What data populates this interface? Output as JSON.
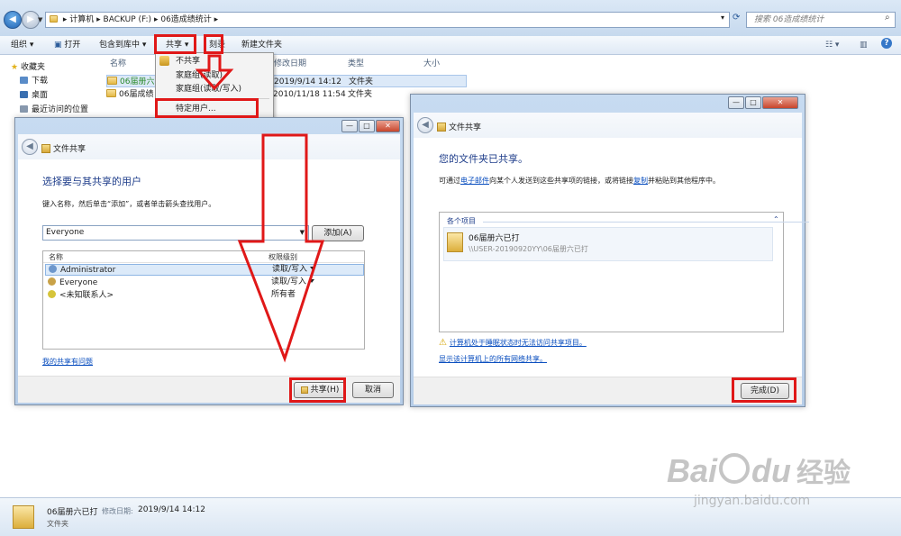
{
  "explorer": {
    "address": {
      "parts": [
        "计算机",
        "BACKUP (F:)",
        "06造成绩统计"
      ]
    },
    "search_placeholder": "搜索 06造成绩统计",
    "toolbar": {
      "organize": "组织",
      "open": "打开",
      "include_library": "包含到库中",
      "share": "共享",
      "burn": "刻录",
      "new_folder": "新建文件夹"
    },
    "sidebar": {
      "favorites": "收藏夹",
      "downloads": "下载",
      "desktop": "桌面",
      "recent": "最近访问的位置"
    },
    "columns": {
      "name": "名称",
      "date": "修改日期",
      "type": "类型",
      "size": "大小"
    },
    "files": [
      {
        "name": "06届册六",
        "date": "2019/9/14 14:12",
        "type": "文件夹"
      },
      {
        "name": "06届成绩",
        "date": "2010/11/18 11:54",
        "type": "文件夹"
      }
    ],
    "share_menu": {
      "nobody": "不共享",
      "homegroup_read": "家庭组(读取)",
      "homegroup_rw": "家庭组(读取/写入)",
      "specific": "特定用户..."
    },
    "status": {
      "name": "06届册六已打",
      "date_label": "修改日期:",
      "date": "2019/9/14 14:12",
      "type": "文件夹"
    }
  },
  "dialog_left": {
    "title": "文件共享",
    "heading": "选择要与其共享的用户",
    "instruction": "键入名称，然后单击“添加”，或者单击箭头查找用户。",
    "input_value": "Everyone",
    "add_button": "添加(A)",
    "col_name": "名称",
    "col_permission": "权限级别",
    "users": [
      {
        "name": "Administrator",
        "permission": "读取/写入"
      },
      {
        "name": "Everyone",
        "permission": "读取/写入"
      },
      {
        "name": "<未知联系人>",
        "permission": "所有者"
      }
    ],
    "help_link": "我的共享有问题",
    "share_button": "共享(H)",
    "cancel_button": "取消"
  },
  "dialog_right": {
    "title": "文件共享",
    "heading": "您的文件夹已共享。",
    "desc_before": "可通过",
    "desc_link1": "电子邮件",
    "desc_middle": "向某个人发送到这些共享项的链接，或将链接",
    "desc_link2": "复制",
    "desc_after": "并粘贴到其他程序中。",
    "group_label": "各个项目",
    "item_name": "06届册六已打",
    "item_path": "\\\\USER-20190920YY\\06届册六已打",
    "warning_link": "计算机处于睡眠状态时无法访问共享项目。",
    "network_link": "显示该计算机上的所有网络共享。",
    "done_button": "完成(D)"
  },
  "watermark": {
    "brand": "Bai",
    "brand2": "du",
    "cn": "经验",
    "url": "jingyan.baidu.com"
  },
  "colors": {
    "annotation_red": "#e01818",
    "link_blue": "#0b4fbf",
    "heading_blue": "#1e3d8a"
  }
}
